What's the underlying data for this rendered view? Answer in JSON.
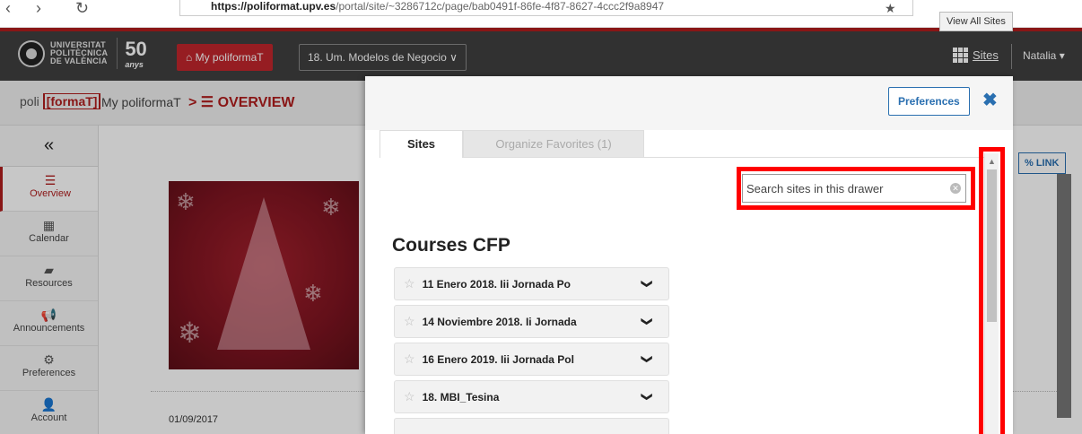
{
  "browser": {
    "back_glyph": "‹",
    "forward_glyph": "›",
    "refresh_glyph": "↻",
    "url_host": "https://poliformat.upv.es",
    "url_path": "/portal/site/~3286712c/page/bab0491f-86fe-4f87-8627-4ccc2f9a8947",
    "tooltip": "View All Sites",
    "bookmark_glyph": "★"
  },
  "header": {
    "logo_lines": [
      "UNIVERSITAT",
      "POLITÈCNICA",
      "DE VALÈNCIA"
    ],
    "anniversary_number": "50",
    "anniversary_word": "anys",
    "my_button": "My poliformaT",
    "site_dropdown": "18. Um. Modelos de Negocio ∨",
    "sites_link": "Sites",
    "user": "Natalia ▾"
  },
  "breadcrumb": {
    "brand_prefix": "poli",
    "brand_suffix": "[formaT]",
    "home": "My poliformaT",
    "current": "> ☰ OVERVIEW"
  },
  "toolbar": {
    "collapse": "«",
    "items": [
      {
        "label": "Overview",
        "icon": "☰"
      },
      {
        "label": "Calendar",
        "icon": "▦"
      },
      {
        "label": "Resources",
        "icon": "▰"
      },
      {
        "label": "Announcements",
        "icon": "📢"
      },
      {
        "label": "Preferences",
        "icon": "⚙"
      },
      {
        "label": "Account",
        "icon": "👤"
      }
    ]
  },
  "main": {
    "link_button": "% LINK",
    "date": "01/09/2017"
  },
  "drawer": {
    "preferences": "Preferences",
    "close": "✖",
    "tabs": [
      {
        "label": "Sites"
      },
      {
        "label": "Organize Favorites (1)"
      }
    ],
    "search_placeholder": "Search sites in this drawer",
    "search_value": "",
    "section_title": "Courses CFP",
    "courses": [
      {
        "name": "11 Enero 2018. Iii Jornada Po"
      },
      {
        "name": "14 Noviembre 2018. Ii Jornada"
      },
      {
        "name": "16 Enero 2019. Iii Jornada Pol"
      },
      {
        "name": "18. MBI_Tesina"
      }
    ]
  },
  "colors": {
    "brand_red": "#b01d1d",
    "link_blue": "#2a6fb0",
    "highlight": "#ff0000",
    "topbar": "#3f3f3f"
  }
}
